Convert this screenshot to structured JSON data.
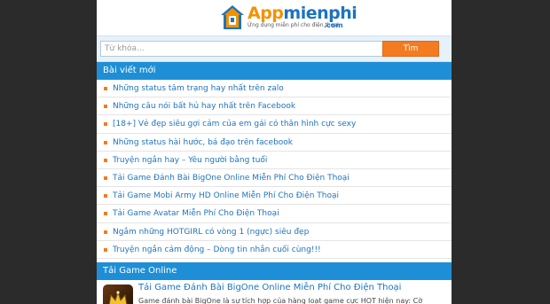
{
  "brand": {
    "name_part1": "App",
    "name_part2": "mienphi",
    "tagline": "Ứng dụng miễn phí cho điện thoại",
    "domain": ".com",
    "color_orange": "#f39200",
    "color_blue": "#1e73be"
  },
  "search": {
    "placeholder": "Từ khóa...",
    "button_label": "Tìm"
  },
  "recent": {
    "title": "Bài viết mới",
    "items": [
      "Những status tâm trạng hay nhất trên zalo",
      "Những câu nói bất hủ hay nhất trên Facebook",
      "[18+] Vẻ đẹp siêu gợi cảm của em gái có thân hình cực sexy",
      "Những status hài hước, bá đạo trên facebook",
      "Truyện ngắn hay – Yêu người bằng tuổi",
      "Tải Game Đánh Bài BigOne Online Miễn Phí Cho Điện Thoại",
      "Tải Game Mobi Army HD Online Miễn Phí Cho Điện Thoại",
      "Tải Game Avatar Miễn Phí Cho Điện Thoại",
      "Ngắm những HOTGIRL có vòng 1 (ngực) siêu đẹp",
      "Truyện ngắn cảm động – Dòng tin nhắn cuối cùng!!!"
    ]
  },
  "games": {
    "title": "Tải Game Online",
    "featured": {
      "title": "Tải Game Đánh Bài BigOne Online Miễn Phí Cho Điện Thoại",
      "description": "Game đánh bài BigOne là sự tích hợp của hàng loạt game cực HOT hiện nay: Cờ"
    }
  }
}
